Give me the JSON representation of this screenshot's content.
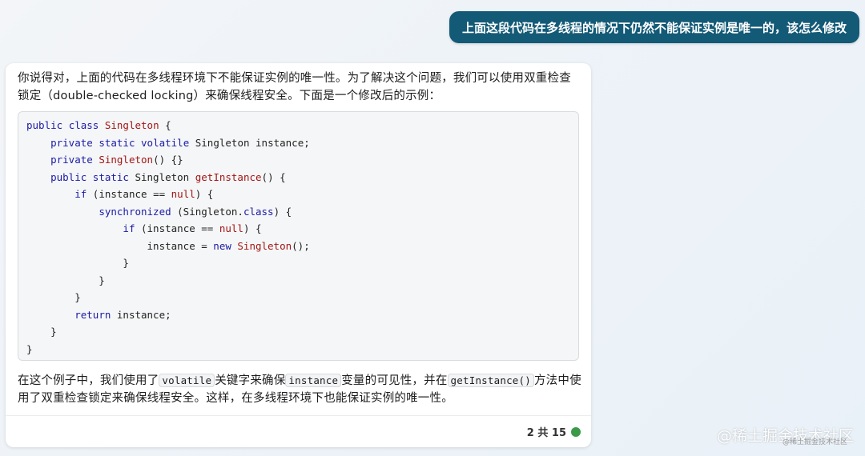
{
  "user_message": "上面这段代码在多线程的情况下仍然不能保证实例是唯一的，该怎么修改",
  "reply": {
    "intro": "你说得对，上面的代码在多线程环境下不能保证实例的唯一性。为了解决这个问题，我们可以使用双重检查锁定（double-checked locking）来确保线程安全。下面是一个修改后的示例：",
    "code_lines": [
      "public class Singleton {",
      "    private static volatile Singleton instance;",
      "    private Singleton() {}",
      "    public static Singleton getInstance() {",
      "        if (instance == null) {",
      "            synchronized (Singleton.class) {",
      "                if (instance == null) {",
      "                    instance = new Singleton();",
      "                }",
      "            }",
      "        }",
      "        return instance;",
      "    }",
      "}"
    ],
    "outro": {
      "part1": "在这个例子中，我们使用了",
      "code1": "volatile",
      "part2": "关键字来确保",
      "code2": "instance",
      "part3": "变量的可见性，并在",
      "code3": "getInstance()",
      "part4": "方法中使用了双重检查锁定来确保线程安全。这样，在多线程环境下也能保证实例的唯一性。"
    },
    "footer": {
      "counter": "2 共 15",
      "status_color": "#3a9a4a"
    }
  },
  "watermark": {
    "main": "@稀土掘金技术社区",
    "sub": "@稀土掘金技术社区"
  },
  "colors": {
    "user_bubble": "#135a77",
    "keyword": "#1a1aa6",
    "type_name": "#a31515"
  }
}
